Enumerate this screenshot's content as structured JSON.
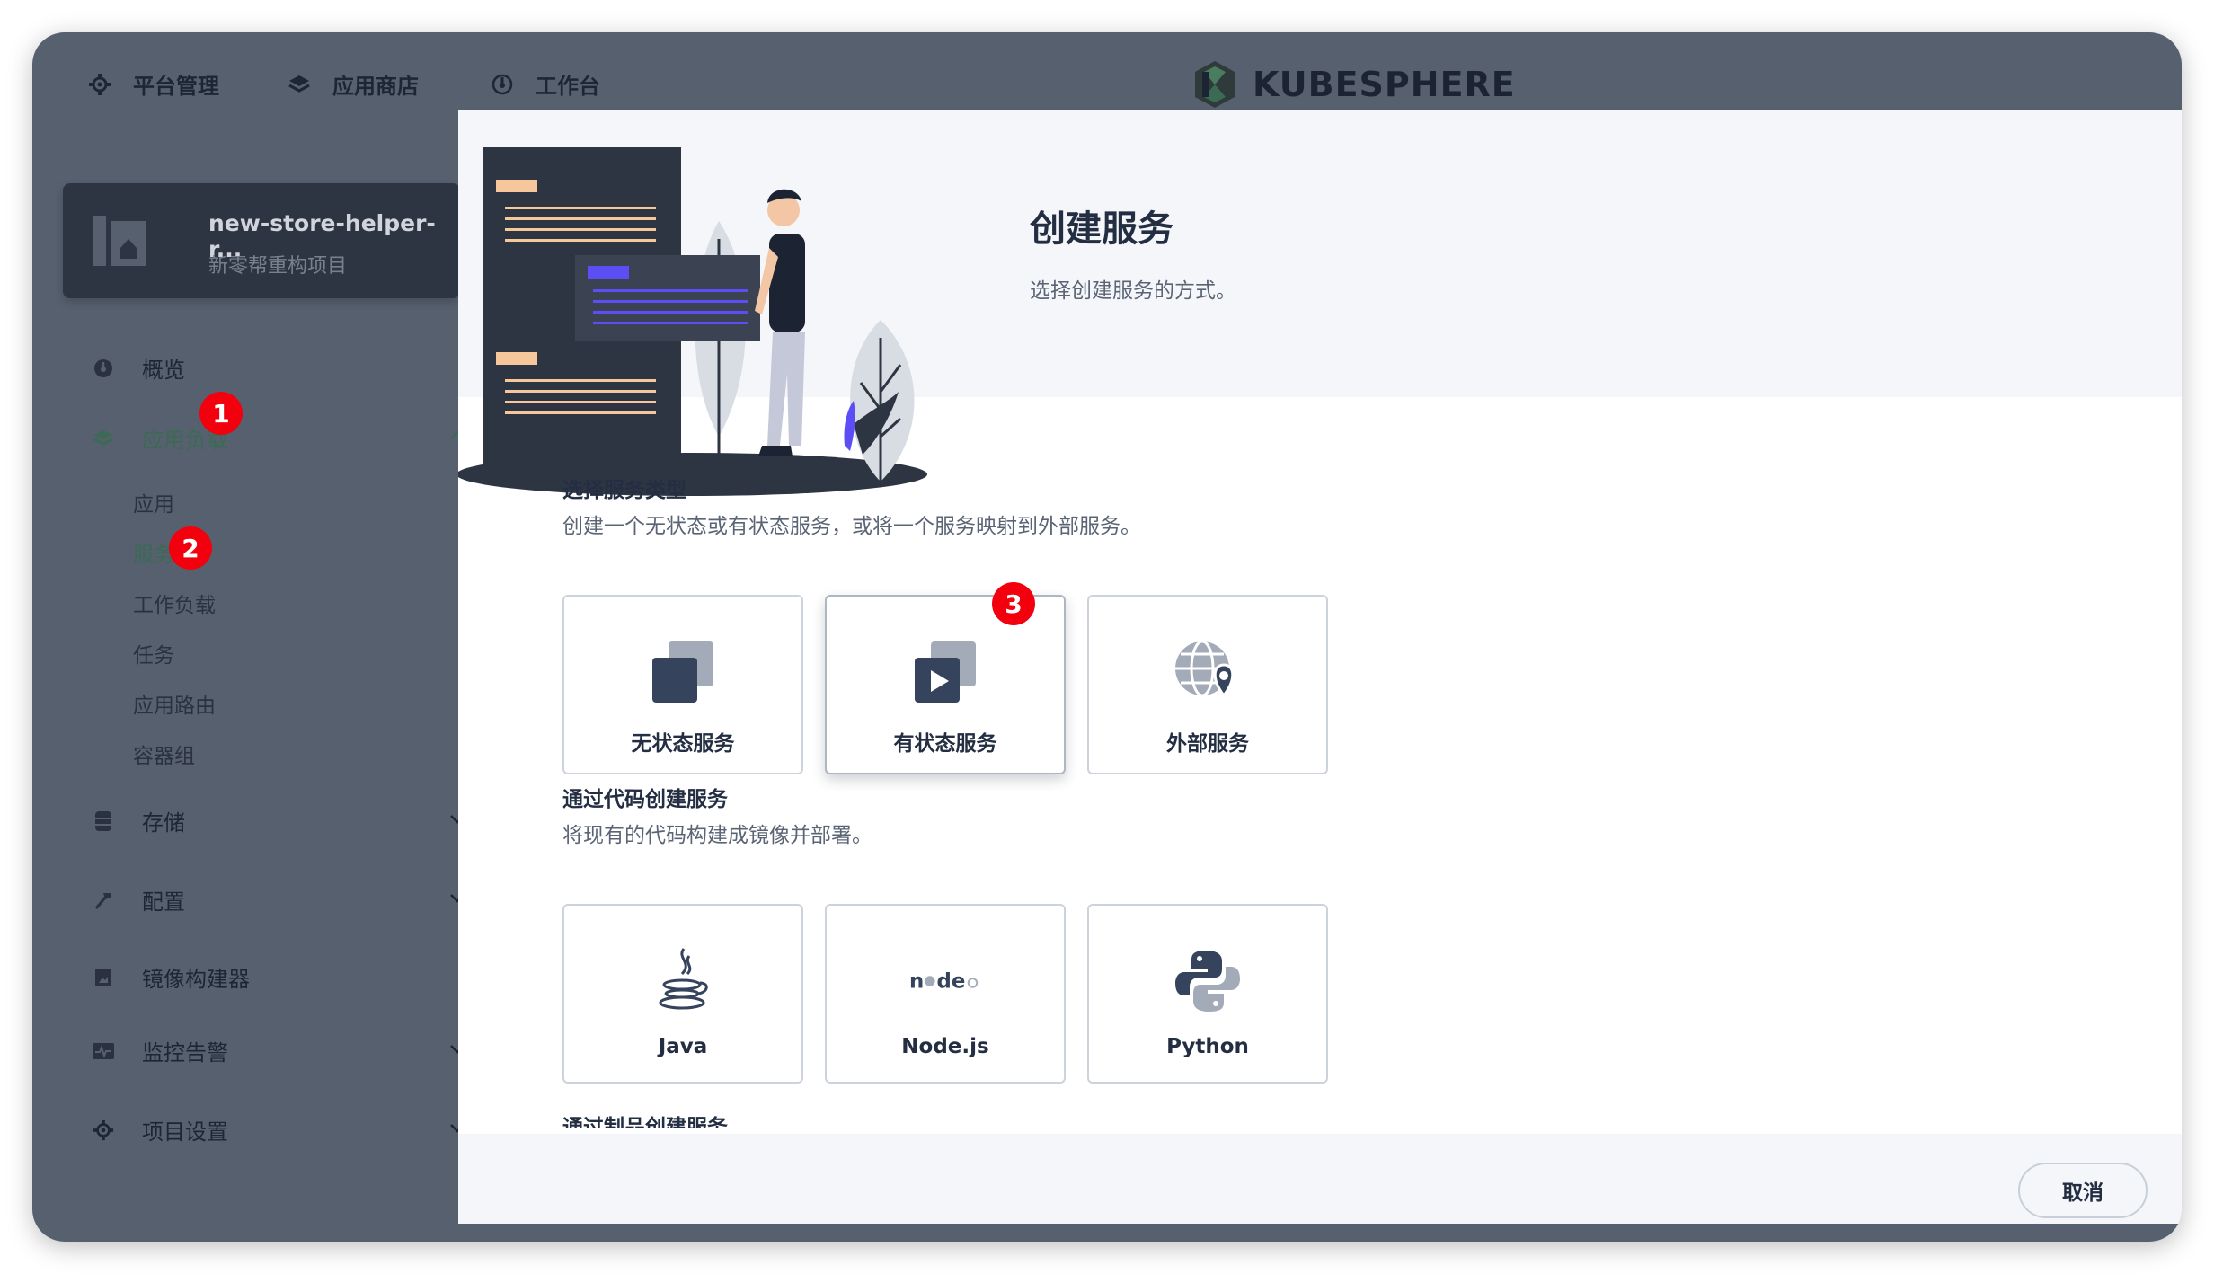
{
  "topnav": {
    "platform": "平台管理",
    "appstore": "应用商店",
    "workbench": "工作台",
    "logo_text": "KUBESPHERE"
  },
  "project": {
    "name": "new-store-helper-r...",
    "desc": "新零帮重构项目"
  },
  "sidebar": {
    "overview": "概览",
    "app_workloads": "应用负载",
    "sub": {
      "apps": "应用",
      "services": "服务",
      "workloads": "工作负载",
      "jobs": "任务",
      "routes": "应用路由",
      "pods": "容器组"
    },
    "storage": "存储",
    "config": "配置",
    "image_builder": "镜像构建器",
    "monitoring": "监控告警",
    "project_settings": "项目设置"
  },
  "badges": [
    "1",
    "2",
    "3"
  ],
  "modal": {
    "title": "创建服务",
    "subtitle": "选择创建服务的方式。",
    "section1_title": "选择服务类型",
    "section1_desc": "创建一个无状态或有状态服务，或将一个服务映射到外部服务。",
    "section2_title": "通过代码创建服务",
    "section2_desc": "将现有的代码构建成镜像并部署。",
    "section3_title_cut": "通过制品创建服务",
    "service_types": {
      "stateless": "无状态服务",
      "stateful": "有状态服务",
      "external": "外部服务"
    },
    "languages": {
      "java": "Java",
      "node": "Node.js",
      "python": "Python"
    },
    "cancel": "取消"
  },
  "colors": {
    "accent_green": "#3b6a55",
    "badge_red": "#f2000d",
    "dark": "#242e42"
  }
}
